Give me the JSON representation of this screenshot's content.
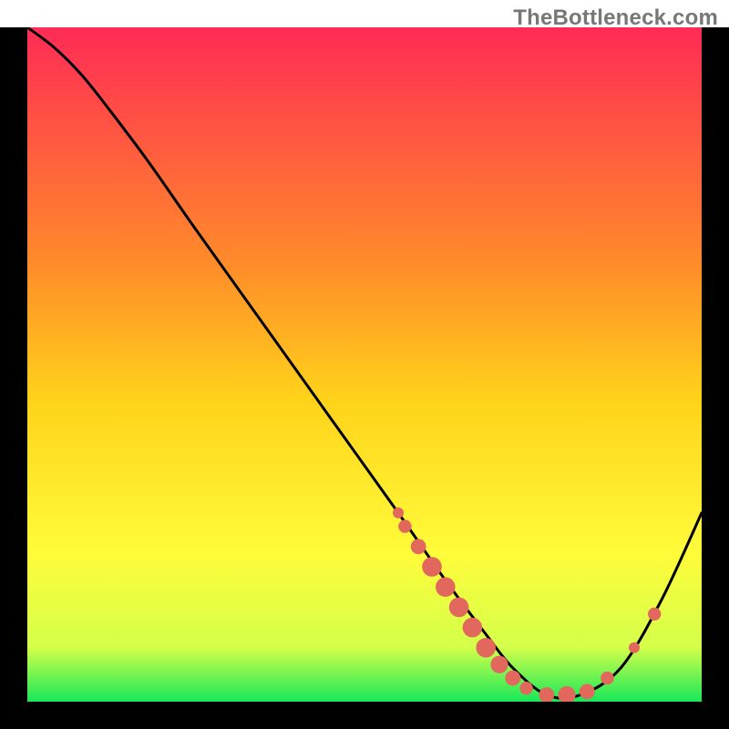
{
  "watermark": "TheBottleneck.com",
  "chart_data": {
    "type": "line",
    "title": "",
    "xlabel": "",
    "ylabel": "",
    "xlim": [
      0,
      100
    ],
    "ylim": [
      0,
      100
    ],
    "gradient_stops": [
      {
        "offset": 0,
        "color": "#ff2b55"
      },
      {
        "offset": 35,
        "color": "#ff8b2a"
      },
      {
        "offset": 55,
        "color": "#ffd21a"
      },
      {
        "offset": 78,
        "color": "#fffc3a"
      },
      {
        "offset": 92,
        "color": "#d3ff4a"
      },
      {
        "offset": 100,
        "color": "#17e858"
      }
    ],
    "series": [
      {
        "name": "bottleneck-curve",
        "x": [
          0,
          4,
          8,
          12,
          18,
          25,
          35,
          45,
          55,
          62,
          68,
          72,
          77,
          82,
          88,
          94,
          100
        ],
        "y": [
          100,
          97,
          93,
          88,
          80,
          70,
          56,
          42,
          28,
          18,
          10,
          5,
          1,
          1,
          5,
          15,
          28
        ]
      }
    ],
    "markers": {
      "name": "highlight-dots",
      "color": "#e2675c",
      "points": [
        {
          "x": 55,
          "y": 28,
          "r": 1.0
        },
        {
          "x": 56,
          "y": 26,
          "r": 1.2
        },
        {
          "x": 58,
          "y": 23,
          "r": 1.4
        },
        {
          "x": 60,
          "y": 20,
          "r": 1.8
        },
        {
          "x": 62,
          "y": 17,
          "r": 1.8
        },
        {
          "x": 64,
          "y": 14,
          "r": 1.8
        },
        {
          "x": 66,
          "y": 11,
          "r": 1.8
        },
        {
          "x": 68,
          "y": 8,
          "r": 1.8
        },
        {
          "x": 70,
          "y": 5.5,
          "r": 1.6
        },
        {
          "x": 72,
          "y": 3.5,
          "r": 1.4
        },
        {
          "x": 74,
          "y": 2.0,
          "r": 1.2
        },
        {
          "x": 77,
          "y": 1.0,
          "r": 1.4
        },
        {
          "x": 80,
          "y": 1.0,
          "r": 1.6
        },
        {
          "x": 83,
          "y": 1.5,
          "r": 1.4
        },
        {
          "x": 86,
          "y": 3.5,
          "r": 1.2
        },
        {
          "x": 90,
          "y": 8.0,
          "r": 1.0
        },
        {
          "x": 93,
          "y": 13.0,
          "r": 1.2
        }
      ]
    }
  }
}
